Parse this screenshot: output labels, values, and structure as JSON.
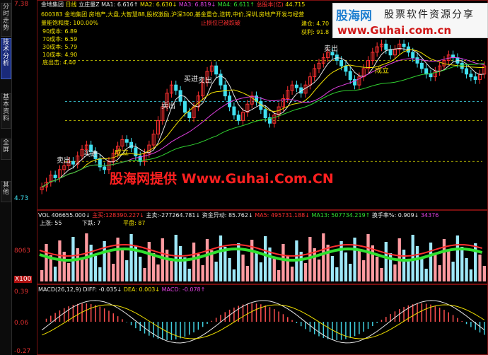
{
  "sidebar": {
    "tabs": [
      {
        "label": "分时走势",
        "active": false
      },
      {
        "label": "技术分析",
        "active": true
      },
      {
        "label": "基本资料",
        "active": false
      },
      {
        "label": "全屏",
        "active": false
      },
      {
        "label": "其他",
        "active": false
      }
    ]
  },
  "axis": {
    "top_price": "7.38",
    "low_price": "4.73",
    "vol_level": "8063",
    "vol_unit": "X100",
    "macd_levels": [
      "0.39",
      "0.06",
      "-0.27"
    ]
  },
  "header": {
    "stock_name": "金地集团",
    "period": "日线",
    "indicator": "立庄量Z",
    "ma1": "MA1: 6.616↑",
    "ma2": "MA2: 6.630↓",
    "ma3": "MA3: 6.819↓",
    "ma4": "MA4: 6.611↑",
    "capital_label": "总股本(亿)",
    "capital_value": "44.715"
  },
  "info": {
    "code": "600383",
    "tags": "金地集团 房地产,大盘,大智慧88,股权激励,沪深300,基金重仓,送转,中价,深圳,房地产开发与经营",
    "cost_line": "量能饱和度: 100.00%",
    "costs": [
      "90成本: 6.89",
      "70成本: 6.59",
      "30成本: 5.79",
      "10成本: 4.90",
      "底出击: 4.40"
    ],
    "build": "建仓: 4.70",
    "profit": "获利: 91.8",
    "red_caption": "止损位已被跌破"
  },
  "annotations": {
    "sell": "卖出",
    "buy": "买进",
    "establish": "成立",
    "sell_set": "卖出"
  },
  "vol": {
    "vol": "VOL 406655.000↓",
    "buy": "主买:128390.227↓",
    "sell": "主卖:-277264.781↓",
    "flow": "资金异动: 85.762↓",
    "ma5": "MA5: 495731.188↓",
    "ma13": "MA13: 507734.219↑",
    "turnover": "换手率%: 0.909↓",
    "last": "34376",
    "up": "上涨: 55",
    "down": "下跌: 7",
    "flat": "平盘: 87"
  },
  "macd": {
    "label": "MACD(26,12,9)",
    "diff": "DIFF: -0.035↓",
    "dea": "DEA: 0.003↓",
    "macd": "MACD: -0.078↑"
  },
  "watermark": {
    "text": "股海网提供 Www.Guhai.Com.CN"
  },
  "logo": {
    "brand": "股海网",
    "sub": "股票软件资源分享",
    "url": "www.Guhai.com.cn"
  },
  "colors": {
    "up": "#ff3030",
    "down": "#40e0f0",
    "ma_green": "#30d030",
    "ma_yellow": "#f0e000",
    "ma_magenta": "#e040e0",
    "ma_white": "#e8e8e8"
  },
  "chart_data": {
    "type": "candlestick",
    "closes": [
      4.73,
      4.82,
      4.95,
      4.9,
      5.05,
      5.12,
      5.2,
      5.15,
      5.3,
      5.42,
      5.5,
      5.38,
      5.25,
      5.1,
      5.05,
      5.2,
      5.35,
      5.48,
      5.6,
      5.55,
      5.45,
      5.3,
      5.2,
      5.35,
      5.5,
      5.7,
      5.95,
      6.2,
      6.45,
      6.6,
      6.5,
      6.3,
      6.1,
      6.0,
      6.2,
      6.4,
      6.65,
      6.85,
      6.95,
      6.8,
      6.6,
      6.4,
      6.2,
      6.05,
      5.95,
      6.1,
      6.25,
      6.4,
      6.3,
      6.15,
      6.0,
      5.9,
      6.05,
      6.2,
      6.35,
      6.5,
      6.6,
      6.55,
      6.45,
      6.6,
      6.75,
      6.9,
      7.0,
      7.1,
      7.2,
      7.15,
      7.05,
      6.95,
      6.85,
      6.7,
      6.6,
      6.75,
      6.9,
      7.05,
      7.2,
      7.3,
      7.35,
      7.25,
      7.15,
      7.25,
      7.35,
      7.3,
      7.2,
      7.1,
      7.0,
      6.9,
      6.8,
      6.75,
      6.85,
      6.95,
      7.05,
      7.15,
      7.1,
      7.0,
      6.9,
      6.8,
      6.75,
      6.7,
      6.8,
      6.95
    ],
    "volume_max": "34376",
    "macd_range": [
      -0.27,
      0.39
    ]
  }
}
